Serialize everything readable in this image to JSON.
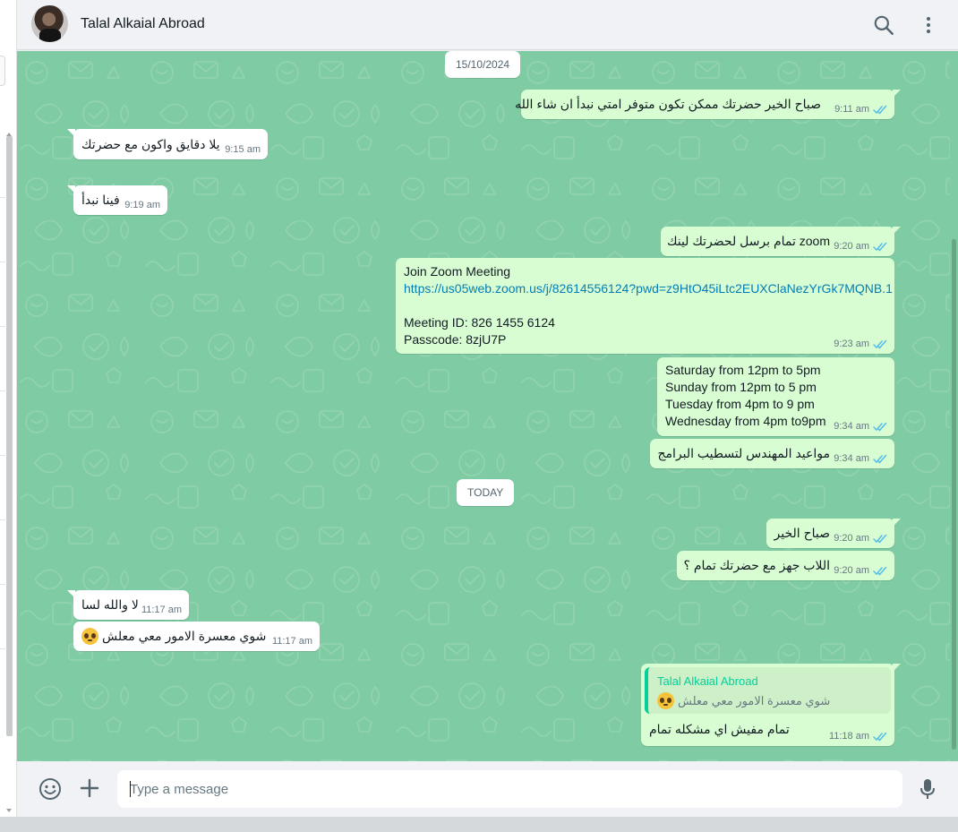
{
  "header": {
    "contact_name": "Talal Alkaial Abroad",
    "search_icon": "search-icon",
    "menu_icon": "vertical-dots-icon"
  },
  "dates": {
    "first": "15/10/2024",
    "today": "TODAY"
  },
  "messages": [
    {
      "dir": "out",
      "text": "صباح الخير حضرتك ممكن تكون متوفر امتي نبدأ ان شاء الله",
      "time": "9:11 am",
      "status": "read"
    },
    {
      "dir": "in",
      "text": "يلا دقايق واكون مع حضرتك",
      "time": "9:15 am"
    },
    {
      "dir": "in",
      "text": "فينا نبدأ",
      "time": "9:19 am"
    },
    {
      "dir": "out",
      "text": "تمام برسل لحضرتك لينك zoom",
      "time": "9:20 am",
      "status": "read"
    },
    {
      "dir": "out",
      "lines": [
        "Join Zoom Meeting",
        "https://us05web.zoom.us/j/82614556124?pwd=z9HtO45iLtc2EUXClaNezYrGk7MQNB.1",
        "",
        "Meeting ID: 826 1455 6124",
        "Passcode: 8zjU7P"
      ],
      "time": "9:23 am",
      "status": "read"
    },
    {
      "dir": "out",
      "lines": [
        "Saturday from 12pm to 5pm",
        "Sunday from 12pm to 5 pm",
        "Tuesday from 4pm to 9 pm",
        "Wednesday from 4pm to9pm"
      ],
      "time": "9:34 am",
      "status": "read"
    },
    {
      "dir": "out",
      "text": "مواعيد المهندس لتسطيب البرامج",
      "time": "9:34 am",
      "status": "read"
    },
    {
      "dir": "out",
      "text": "صباح الخير",
      "time": "9:20 am",
      "status": "read"
    },
    {
      "dir": "out",
      "text": "اللاب جهز مع حضرتك تمام ؟",
      "time": "9:20 am",
      "status": "read"
    },
    {
      "dir": "in",
      "text": "لا والله لسا",
      "time": "11:17 am"
    },
    {
      "dir": "in",
      "text": "شوي معسرة الامور معي معلش",
      "time": "11:17 am",
      "emoji": "pleading-face-emoji"
    },
    {
      "dir": "out",
      "quote_name": "Talal Alkaial Abroad",
      "quote_text": "شوي معسرة الامور معي معلش",
      "text": "تمام مفيش اي مشكله تمام",
      "time": "11:18 am",
      "status": "read"
    }
  ],
  "footer": {
    "placeholder": "Type a message",
    "emoji_icon": "smiley-icon",
    "attach_icon": "plus-icon",
    "mic_icon": "mic-icon"
  },
  "colors": {
    "wallpaper": "#7fcba3",
    "outgoing_bubble": "#d9fdd3",
    "incoming_bubble": "#ffffff",
    "read_tick": "#53bdeb",
    "link": "#027eb5",
    "quote_accent": "#06cf9c"
  }
}
